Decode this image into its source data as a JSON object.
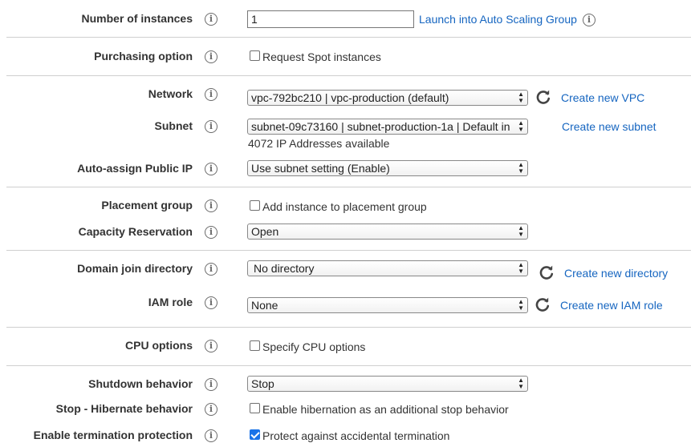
{
  "icons": {
    "info": "info-icon",
    "refresh": "refresh-icon",
    "select_arrows": "select-arrows-icon"
  },
  "colors": {
    "link": "#1565c0",
    "checkbox_checked": "#1a73e8",
    "divider": "#cfcfcf"
  },
  "instances": {
    "label": "Number of instances",
    "info_glyph": "i",
    "value": "1",
    "link": "Launch into Auto Scaling Group"
  },
  "purchasing": {
    "label": "Purchasing option",
    "checkbox_label": "Request Spot instances",
    "checked": false
  },
  "network": {
    "label": "Network",
    "selected": "vpc-792bc210 | vpc-production (default)",
    "create_link": "Create new VPC"
  },
  "subnet": {
    "label": "Subnet",
    "selected": "subnet-09c73160 | subnet-production-1a | Default in",
    "available": "4072 IP Addresses available",
    "create_link": "Create new subnet"
  },
  "public_ip": {
    "label": "Auto-assign Public IP",
    "selected": "Use subnet setting (Enable)"
  },
  "placement": {
    "label": "Placement group",
    "checkbox_label": "Add instance to placement group",
    "checked": false
  },
  "capacity": {
    "label": "Capacity Reservation",
    "selected": "Open"
  },
  "domain": {
    "label": "Domain join directory",
    "selected": "No directory",
    "create_link": "Create new directory"
  },
  "iam": {
    "label": "IAM role",
    "selected": "None",
    "create_link": "Create new IAM role"
  },
  "cpu": {
    "label": "CPU options",
    "checkbox_label": "Specify CPU options",
    "checked": false
  },
  "shutdown": {
    "label": "Shutdown behavior",
    "selected": "Stop"
  },
  "hibernate": {
    "label": "Stop - Hibernate behavior",
    "checkbox_label": "Enable hibernation as an additional stop behavior",
    "checked": false
  },
  "termination": {
    "label": "Enable termination protection",
    "checkbox_label": "Protect against accidental termination",
    "checked": true
  }
}
